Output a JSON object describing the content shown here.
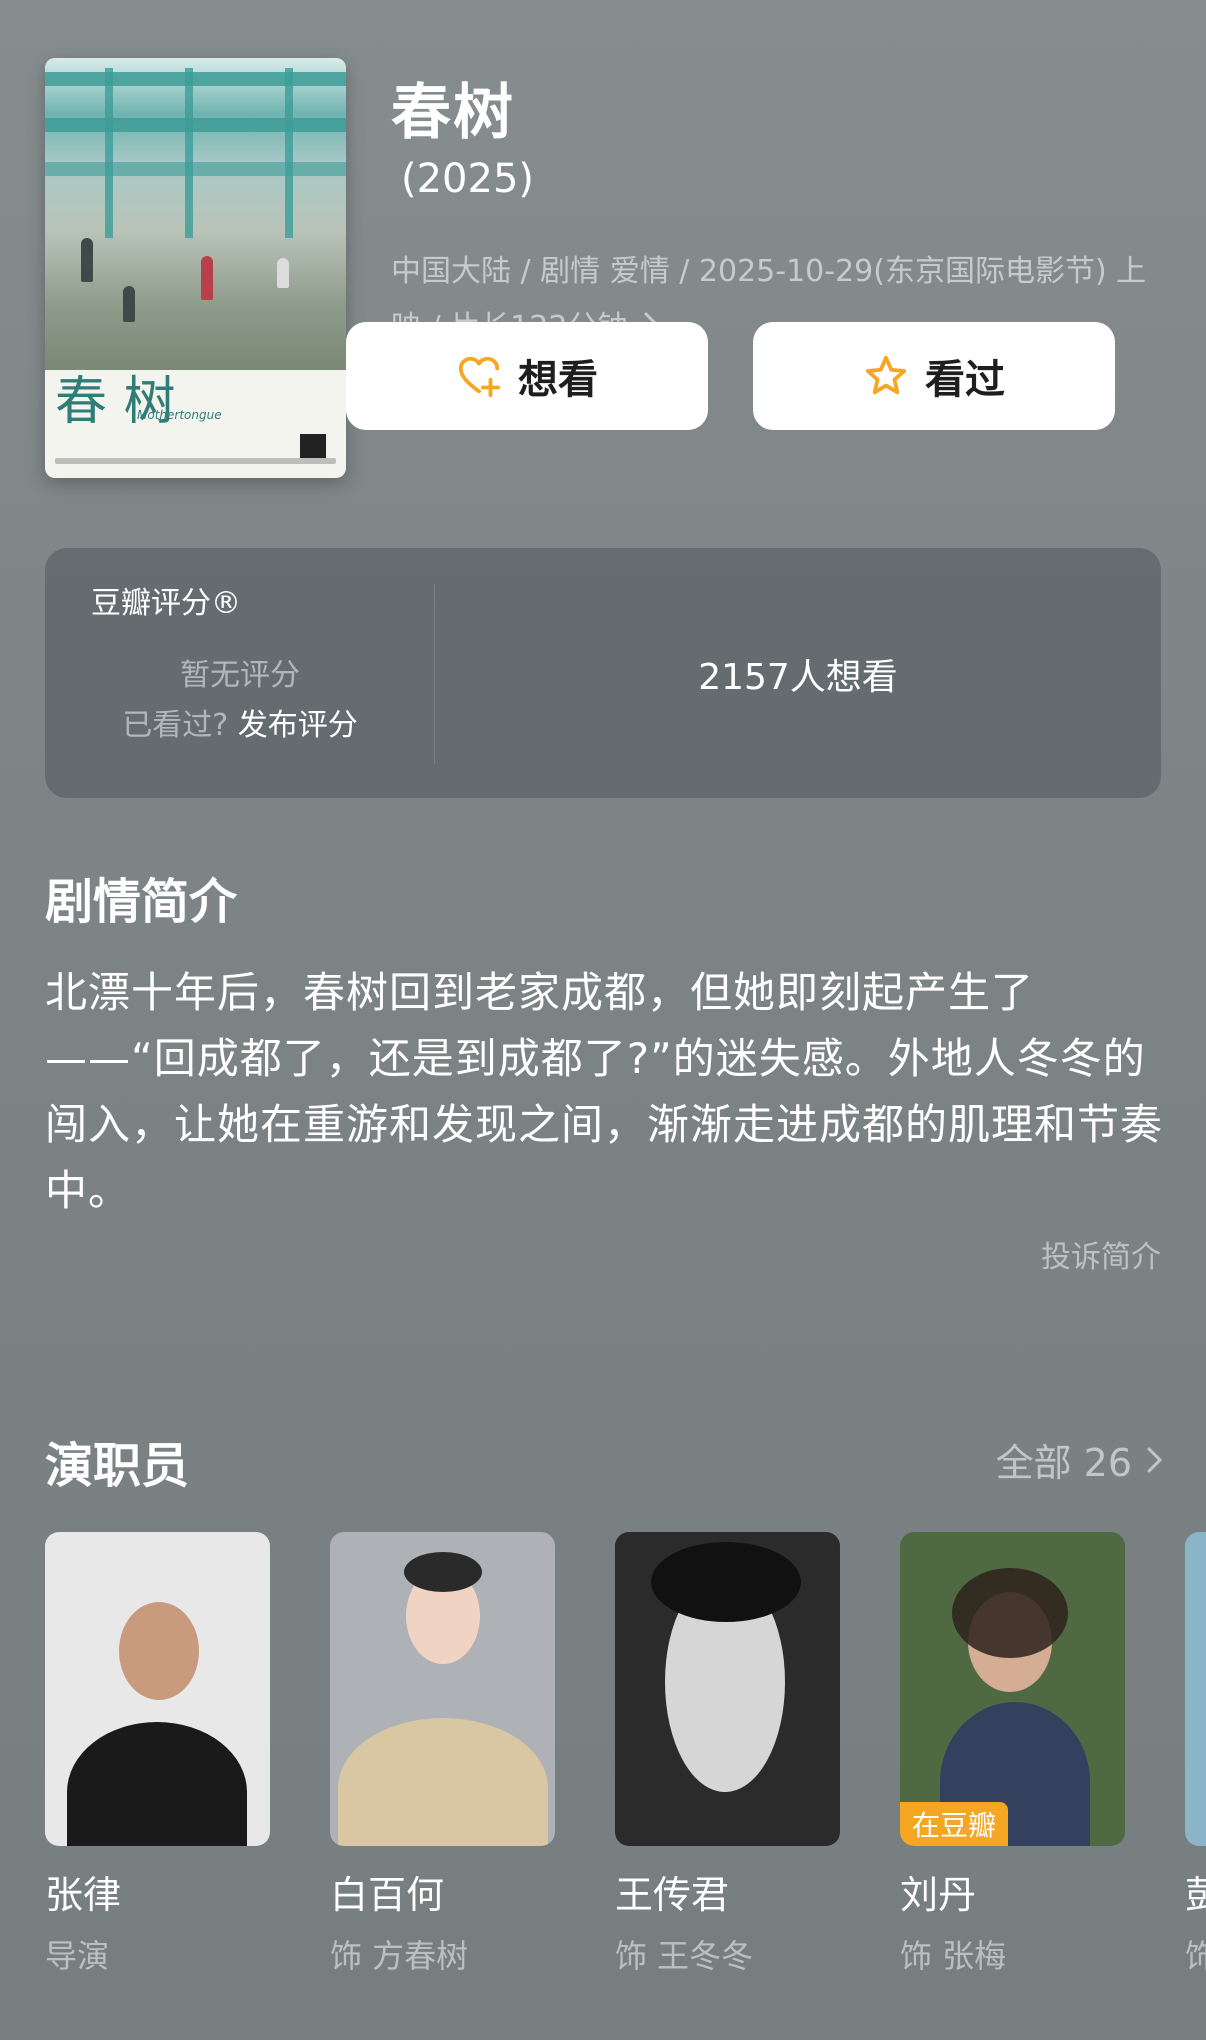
{
  "movie": {
    "title": "春树",
    "year": "(2025)",
    "meta": "中国大陆 / 剧情 爱情 / 2025-10-29(东京国际电影节) 上映 / 片长122分钟",
    "poster": {
      "title_art": "春 树",
      "subtitle": "Mothertongue"
    }
  },
  "actions": {
    "want_label": "想看",
    "seen_label": "看过"
  },
  "rating": {
    "title": "豆瓣评分®",
    "no_rating": "暂无评分",
    "seen_question": "已看过?",
    "post_rating": "发布评分",
    "wish_count": "2157人想看"
  },
  "synopsis": {
    "title": "剧情简介",
    "text": "北漂十年后，春树回到老家成都，但她即刻起产生了——“回成都了，还是到成都了?”的迷失感。外地人冬冬的闯入，让她在重游和发现之间，渐渐走进成都的肌理和节奏中。",
    "complain": "投诉简介"
  },
  "cast": {
    "title": "演职员",
    "see_all": "全部 26",
    "members": [
      {
        "name": "张律",
        "role": "导演"
      },
      {
        "name": "白百何",
        "role": "饰 方春树"
      },
      {
        "name": "王传君",
        "role": "饰 王冬冬"
      },
      {
        "name": "刘丹",
        "role": "饰 张梅",
        "badge": "在豆瓣"
      },
      {
        "name": "彭",
        "role": "饰"
      }
    ]
  },
  "colors": {
    "background": "#7c8486",
    "star": "#f5a623",
    "badge": "#f5a623"
  },
  "icons": {
    "want": "heart-plus-icon",
    "seen": "star-icon",
    "meta_more": "chevron-right-icon",
    "see_all": "chevron-right-icon"
  }
}
